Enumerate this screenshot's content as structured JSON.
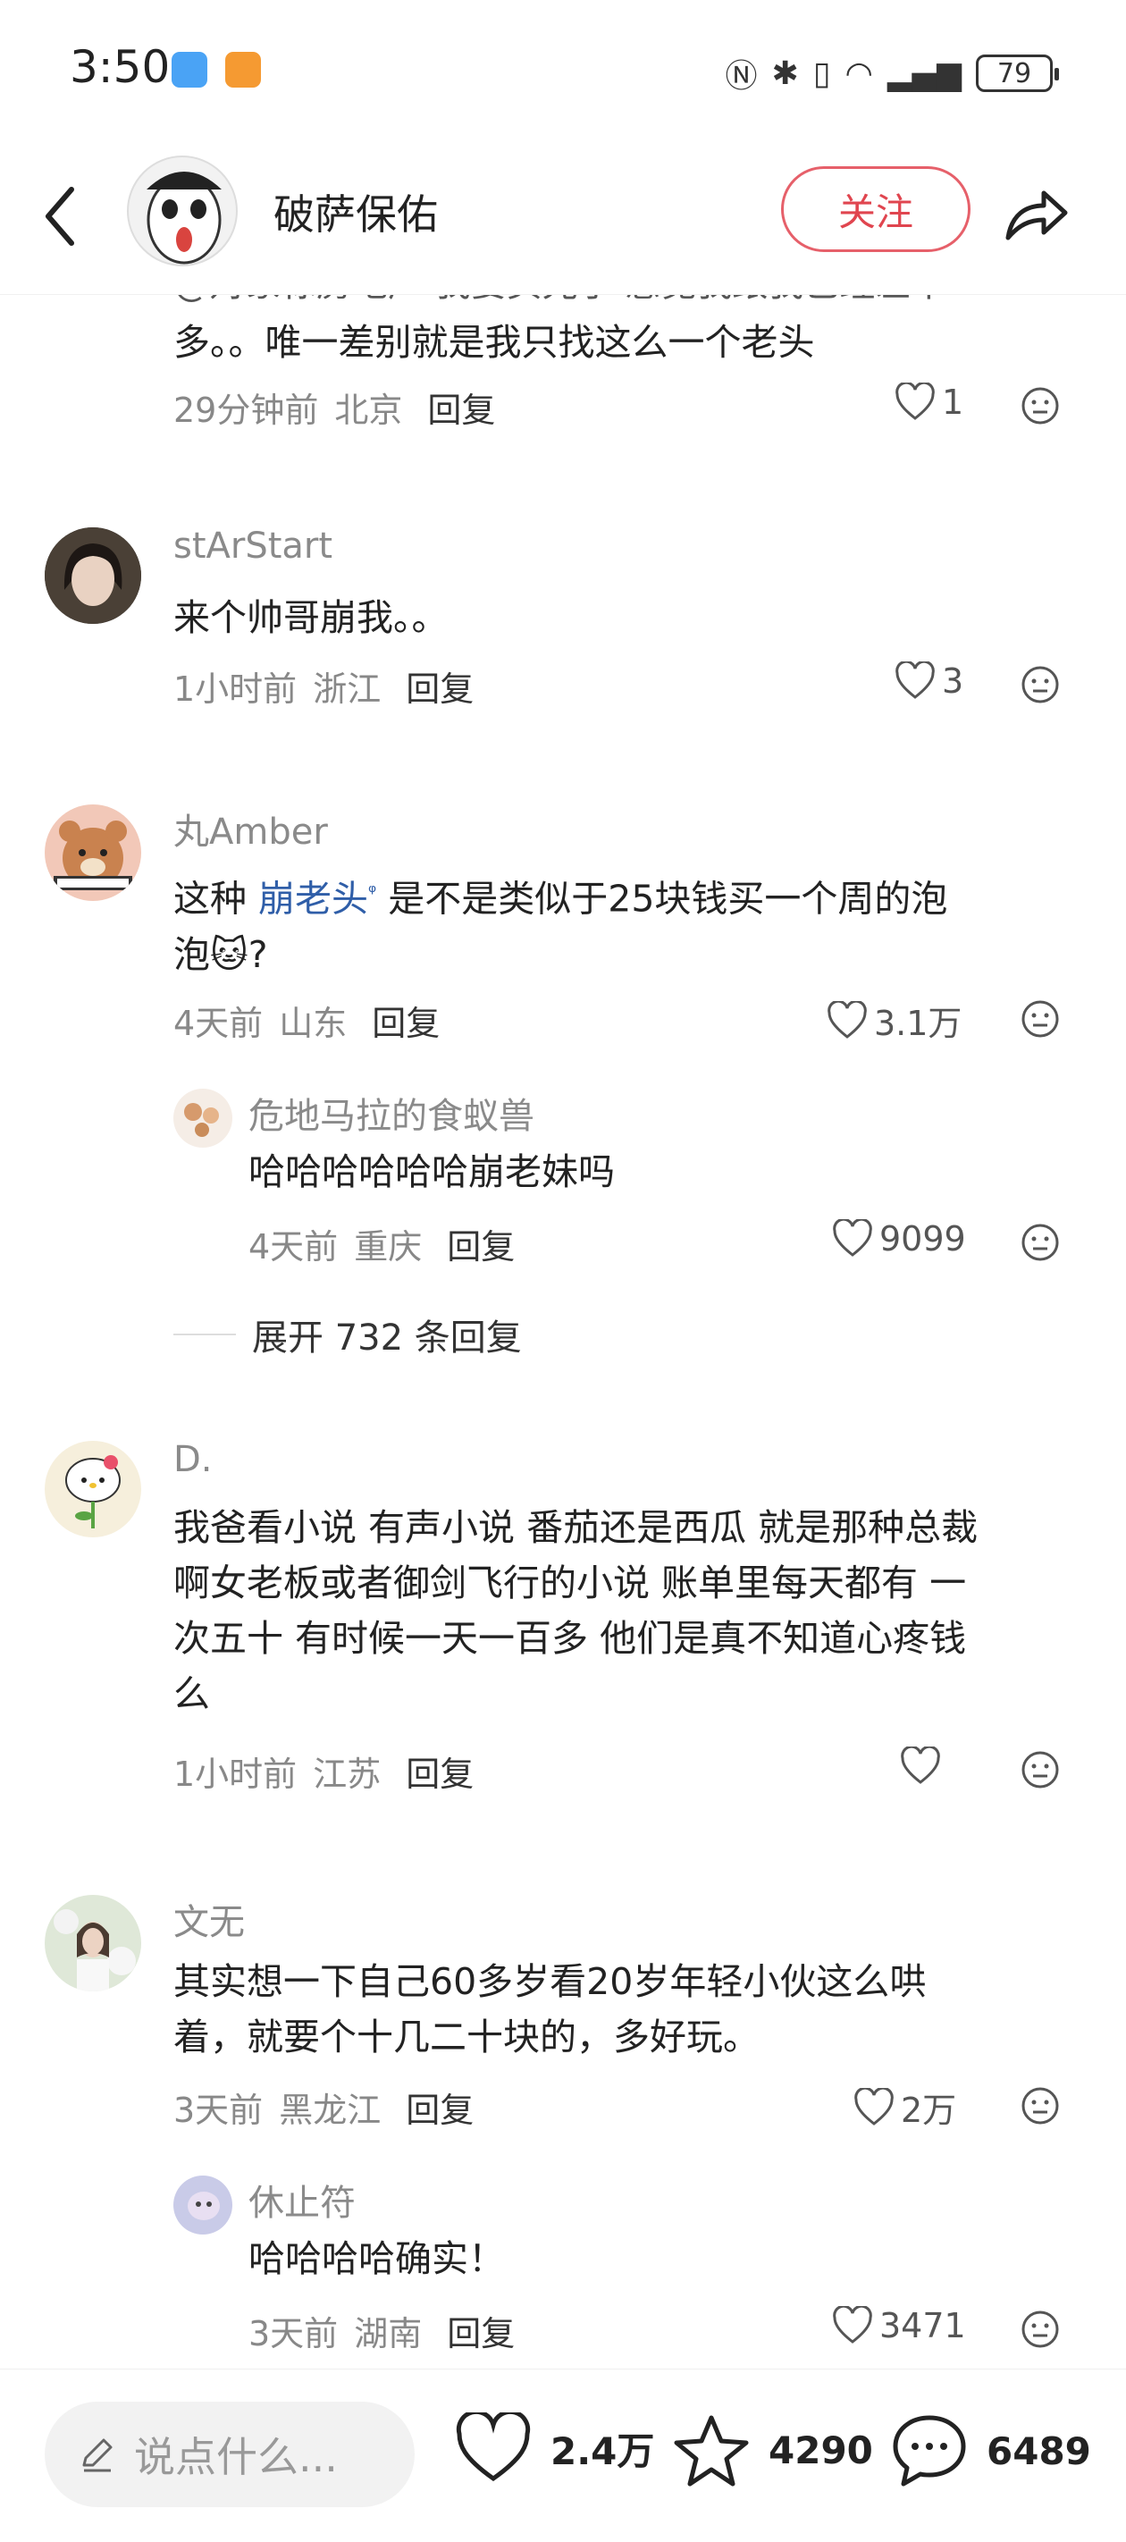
{
  "status": {
    "time": "3:50",
    "battery": "79"
  },
  "header": {
    "username": "破萨保佑",
    "follow_label": "关注"
  },
  "comments": [
    {
      "text_cut": "@对象标房地产 我要买光了 感觉我跟我已经差不",
      "text": "多。。唯一差别就是我只找这么一个老头",
      "time": "29分钟前",
      "location": "北京",
      "reply_label": "回复",
      "likes": "1"
    },
    {
      "username": "stArStart",
      "text": "来个帅哥崩我。。",
      "time": "1小时前",
      "location": "浙江",
      "reply_label": "回复",
      "likes": "3"
    },
    {
      "username": "丸Amber",
      "text_before": "这种",
      "link": "崩老头",
      "text_after": "是不是类似于25块钱买一个周的泡",
      "text_line2": "泡🐱?",
      "time": "4天前",
      "location": "山东",
      "reply_label": "回复",
      "likes": "3.1万",
      "sub_reply": {
        "username": "危地马拉的食蚁兽",
        "text": "哈哈哈哈哈哈崩老妹吗",
        "time": "4天前",
        "location": "重庆",
        "reply_label": "回复",
        "likes": "9099"
      },
      "expand_label": "展开 732 条回复"
    },
    {
      "username": "D.",
      "lines": [
        "我爸看小说 有声小说 番茄还是西瓜 就是那种总裁",
        "啊女老板或者御剑飞行的小说 账单里每天都有 一",
        "次五十 有时候一天一百多 他们是真不知道心疼钱",
        "么"
      ],
      "time": "1小时前",
      "location": "江苏",
      "reply_label": "回复",
      "likes": ""
    },
    {
      "username": "文无",
      "lines": [
        "其实想一下自己60多岁看20岁年轻小伙这么哄",
        "着，就要个十几二十块的，多好玩。"
      ],
      "time": "3天前",
      "location": "黑龙江",
      "reply_label": "回复",
      "likes": "2万",
      "sub_reply": {
        "username": "休止符",
        "text": "哈哈哈哈确实！",
        "time": "3天前",
        "location": "湖南",
        "reply_label": "回复",
        "likes": "3471"
      }
    }
  ],
  "bottom": {
    "input_placeholder": "说点什么...",
    "likes": "2.4万",
    "favorites": "4290",
    "comments": "6489"
  },
  "colors": {
    "accent": "#e0454f",
    "link": "#2f5ea8",
    "meta": "#888888"
  }
}
